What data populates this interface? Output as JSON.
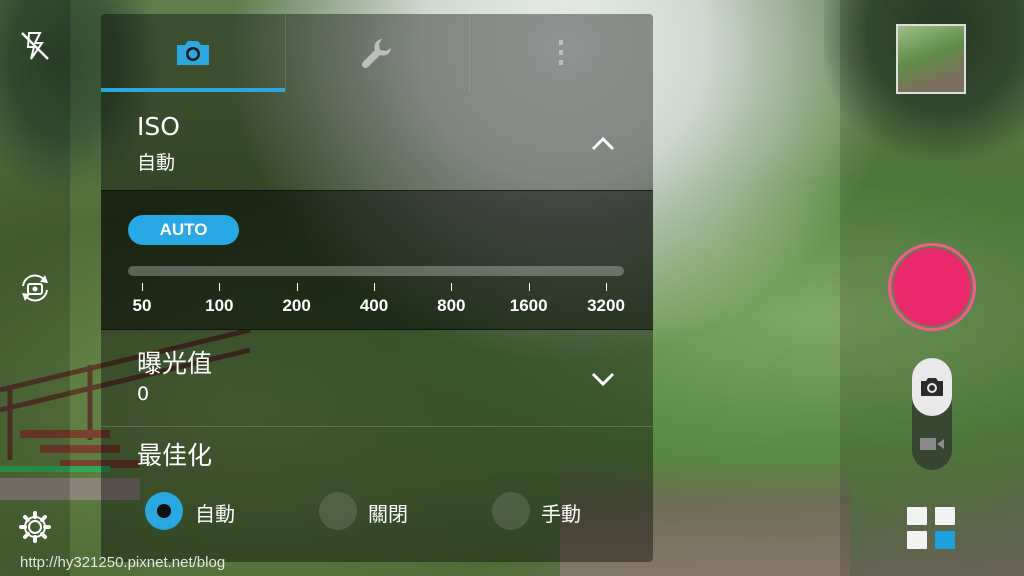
{
  "panel": {
    "tabs": [
      {
        "icon": "camera-icon"
      },
      {
        "icon": "wrench-icon"
      },
      {
        "icon": "more-vert-icon"
      }
    ],
    "iso": {
      "title": "ISO",
      "value": "自動",
      "auto_label": "AUTO",
      "ticks": [
        "50",
        "100",
        "200",
        "400",
        "800",
        "1600",
        "3200"
      ]
    },
    "exposure": {
      "title": "曝光值",
      "value": "0"
    },
    "optimize": {
      "title": "最佳化",
      "options": [
        "自動",
        "關閉",
        "手動"
      ],
      "selected": "自動"
    }
  },
  "left_rail": {
    "icons": [
      "flash-off-icon",
      "switch-camera-icon",
      "settings-gear-icon"
    ]
  },
  "right_rail": {
    "icons": [
      "gallery-thumbnail",
      "shutter-button",
      "photo-mode-icon",
      "video-mode-icon",
      "modes-grid-icon"
    ]
  },
  "watermark": "http://hy321250.pixnet.net/blog",
  "colors": {
    "accent": "#2aa7e0",
    "shutter": "#ea2a6c"
  }
}
